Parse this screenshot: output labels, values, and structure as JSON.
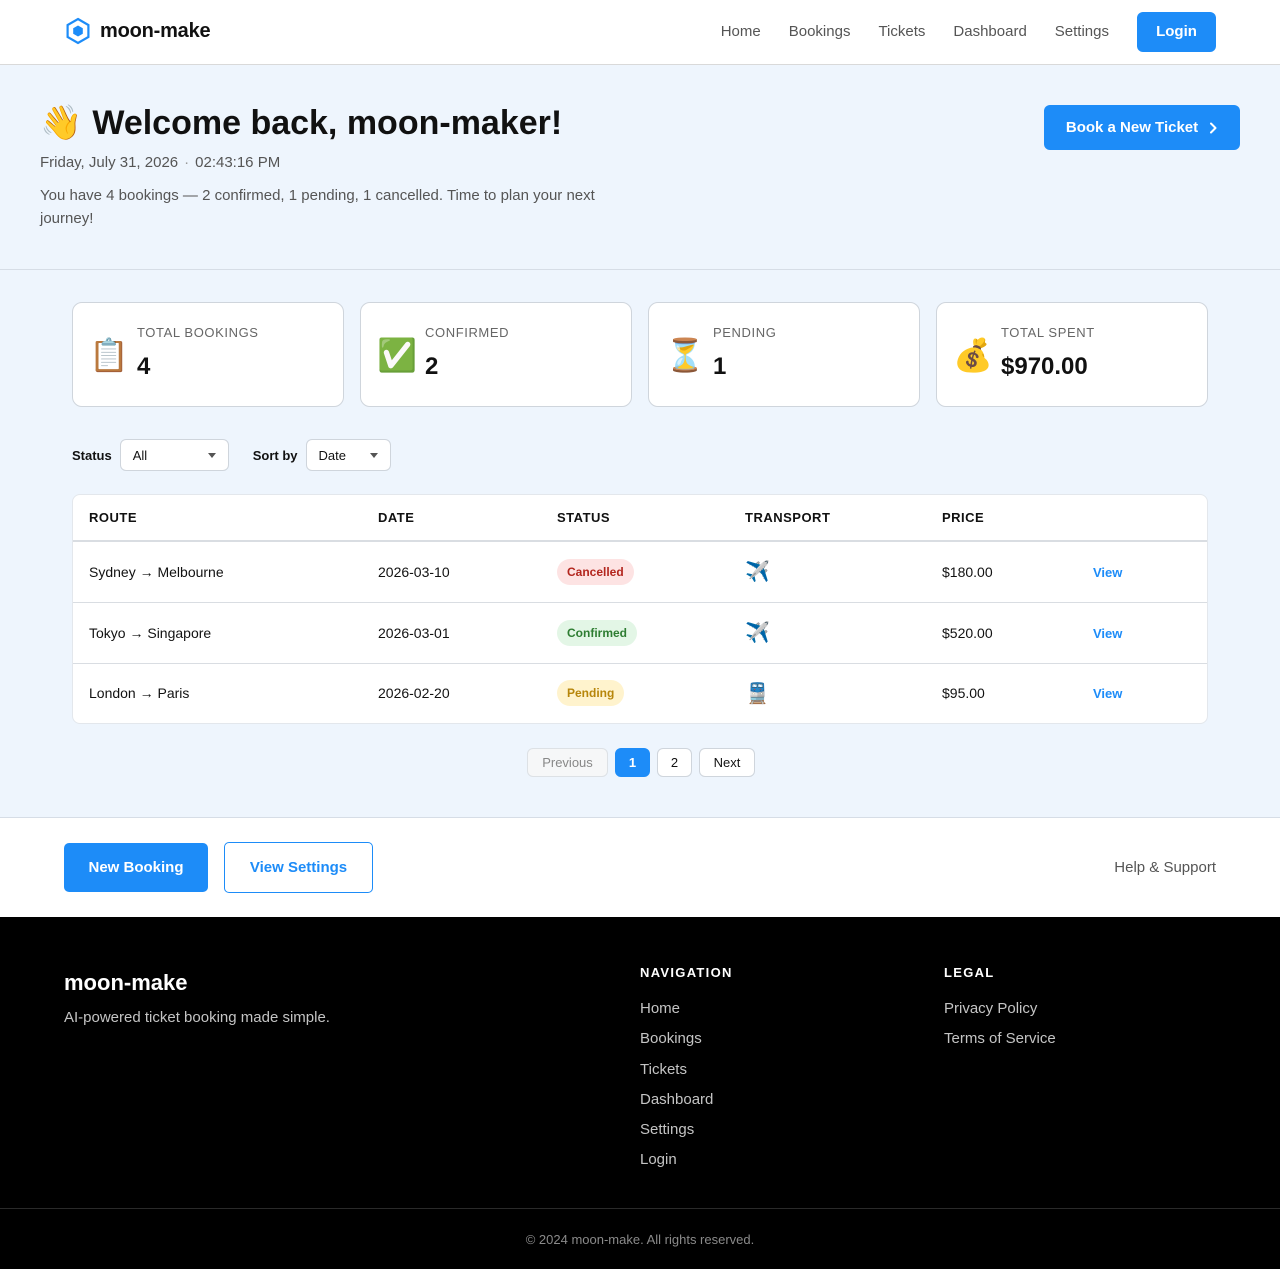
{
  "header": {
    "brand": "moon-make",
    "nav": [
      "Home",
      "Bookings",
      "Tickets",
      "Dashboard",
      "Settings"
    ],
    "login_label": "Login",
    "accent_color": "#1d8cf8"
  },
  "hero": {
    "greeting_emoji": "👋",
    "title": "Welcome back, moon-maker!",
    "date": "Friday, July 31, 2026",
    "separator": "·",
    "time": "02:43:16 PM",
    "summary": "You have 4 bookings — 2 confirmed, 1 pending, 1 cancelled. Time to plan your next journey!",
    "book_button_label": "Book a New Ticket",
    "book_button_icon": "chevron-right-icon"
  },
  "stats": [
    {
      "emoji": "📋",
      "label": "TOTAL BOOKINGS",
      "value": "4"
    },
    {
      "emoji": "✅",
      "label": "CONFIRMED",
      "value": "2"
    },
    {
      "emoji": "⏳",
      "label": "PENDING",
      "value": "1"
    },
    {
      "emoji": "💰",
      "label": "TOTAL SPENT",
      "value": "$970.00"
    }
  ],
  "filters": {
    "status_label": "Status",
    "status_value": "All",
    "sort_label": "Sort by",
    "sort_value": "Date"
  },
  "table": {
    "columns": [
      "ROUTE",
      "DATE",
      "STATUS",
      "TRANSPORT",
      "PRICE",
      ""
    ],
    "rows": [
      {
        "route": "Sydney → Melbourne",
        "date": "2026-03-10",
        "status": "Cancelled",
        "transport": "✈️",
        "price": "$180.00",
        "action": "View"
      },
      {
        "route": "Tokyo → Singapore",
        "date": "2026-03-01",
        "status": "Confirmed",
        "transport": "✈️",
        "price": "$520.00",
        "action": "View"
      },
      {
        "route": "London → Paris",
        "date": "2026-02-20",
        "status": "Pending",
        "transport": "🚆",
        "price": "$95.00",
        "action": "View"
      }
    ]
  },
  "pagination": {
    "previous": "Previous",
    "pages": [
      "1",
      "2"
    ],
    "current": "1",
    "next": "Next"
  },
  "actions": {
    "new_booking": "New Booking",
    "view_settings": "View Settings",
    "help": "Help & Support"
  },
  "footer": {
    "brand": "moon-make",
    "tagline": "AI-powered ticket booking made simple.",
    "navigation_heading": "NAVIGATION",
    "navigation_links": [
      "Home",
      "Bookings",
      "Tickets",
      "Dashboard",
      "Settings",
      "Login"
    ],
    "legal_heading": "LEGAL",
    "legal_links": [
      "Privacy Policy",
      "Terms of Service"
    ],
    "copyright": "© 2024 moon-make. All rights reserved."
  }
}
